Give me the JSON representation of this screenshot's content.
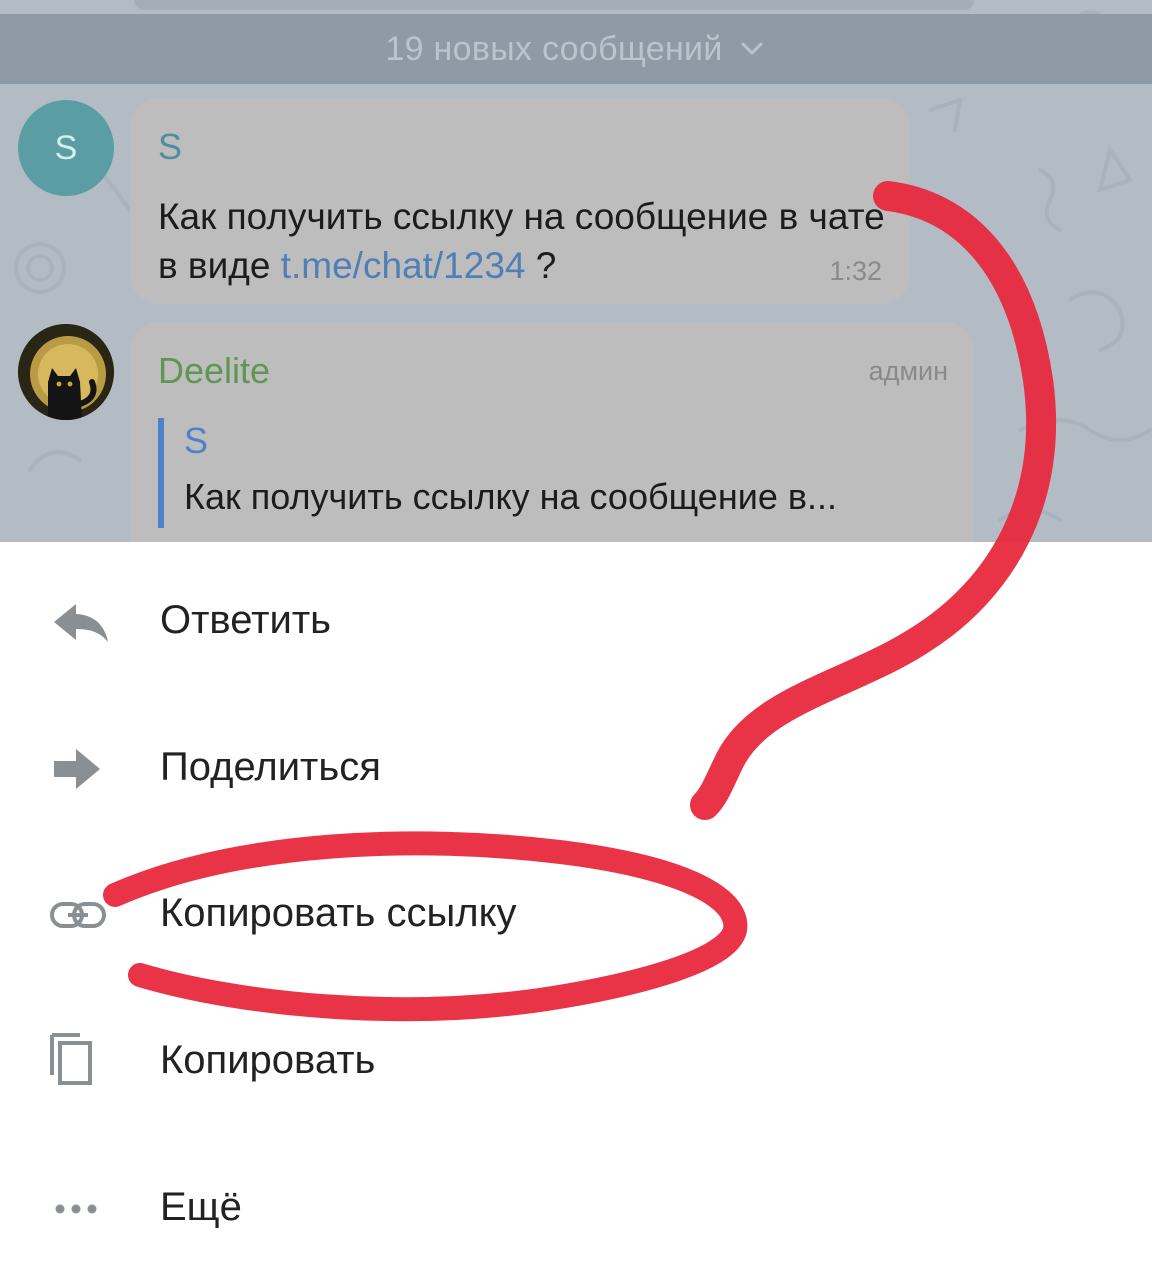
{
  "chat": {
    "new_messages_label": "19 новых сообщений",
    "messages": [
      {
        "avatar_letter": "S",
        "sender": "S",
        "text_before_link": "Как получить ссылку на сообщение в чате в виде ",
        "link_text": "t.me/chat/1234",
        "text_after_link": " ?",
        "time": "1:32"
      },
      {
        "sender": "Deelite",
        "badge": "админ",
        "reply_to_sender": "S",
        "reply_to_text": "Как получить ссылку на сообщение в..."
      }
    ]
  },
  "context_menu": {
    "items": [
      {
        "label": "Ответить",
        "icon": "reply-icon"
      },
      {
        "label": "Поделиться",
        "icon": "share-icon"
      },
      {
        "label": "Копировать ссылку",
        "icon": "link-icon"
      },
      {
        "label": "Копировать",
        "icon": "copy-icon"
      },
      {
        "label": "Ещё",
        "icon": "more-icon"
      }
    ]
  },
  "colors": {
    "annotation": "#e8293e",
    "link": "#4f7fb6",
    "admin_name": "#5e9652",
    "quote_accent": "#4e82c8"
  }
}
